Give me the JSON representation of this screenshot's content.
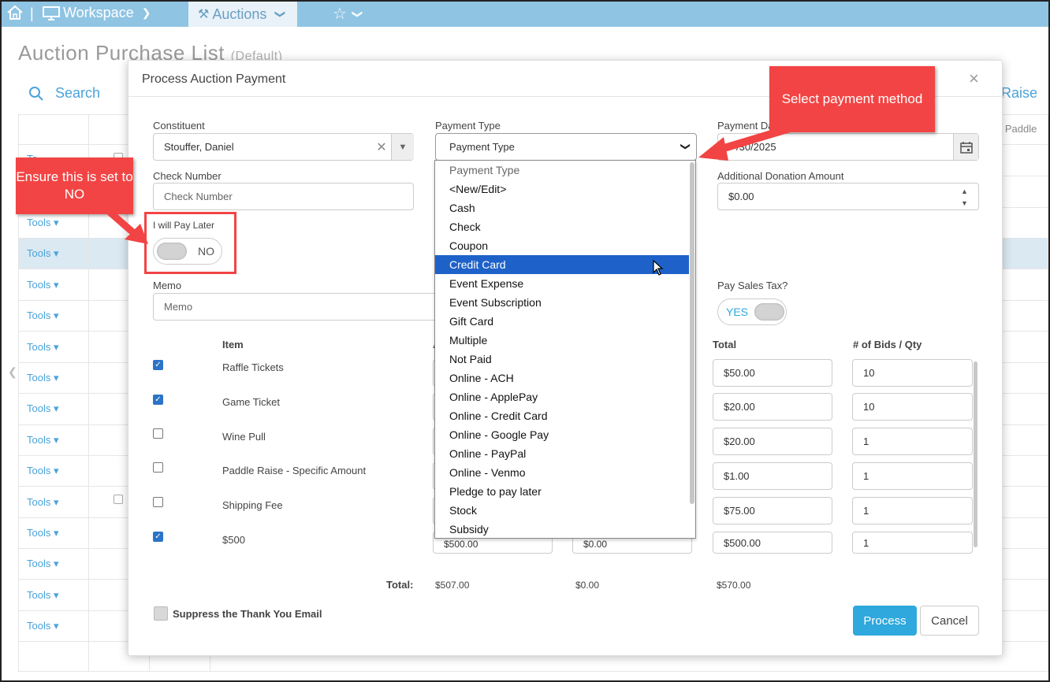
{
  "nav": {
    "workspace": "Workspace",
    "auctions": "Auctions"
  },
  "page": {
    "title": "Auction Purchase List",
    "subtitle": "(Default)",
    "search": "Search",
    "raise_partial": "Raise",
    "paddle_partial": "n Paddle",
    "tools_label": "Tools"
  },
  "modal": {
    "title": "Process Auction Payment",
    "constituent_label": "Constituent",
    "constituent_value": "Stouffer, Daniel",
    "payment_type_label": "Payment Type",
    "payment_type_value": "Payment Type",
    "payment_date_label": "Payment Da",
    "payment_date_value": "/30/2025",
    "check_number_label": "Check Number",
    "check_number_placeholder": "Check Number",
    "additional_donation_label": "Additional Donation Amount",
    "additional_donation_value": "$0.00",
    "pay_later_label": "I will Pay Later",
    "pay_later_value": "NO",
    "memo_label": "Memo",
    "memo_placeholder": "Memo",
    "sales_tax_label": "Pay Sales Tax?",
    "sales_tax_value": "YES",
    "col_item": "Item",
    "col_total": "Total",
    "col_bids": "# of Bids / Qty",
    "items": [
      {
        "name": "Raffle Tickets",
        "checked": true,
        "total": "$50.00",
        "qty": "10"
      },
      {
        "name": "Game Ticket",
        "checked": true,
        "total": "$20.00",
        "qty": "10"
      },
      {
        "name": "Wine Pull",
        "checked": false,
        "total": "$20.00",
        "qty": "1"
      },
      {
        "name": "Paddle Raise - Specific Amount",
        "checked": false,
        "total": "$1.00",
        "qty": "1"
      },
      {
        "name": "Shipping Fee",
        "checked": false,
        "total": "$75.00",
        "qty": "1"
      },
      {
        "name": "$500",
        "checked": true,
        "amount": "$500.00",
        "tax": "$0.00",
        "total": "$500.00",
        "qty": "1"
      }
    ],
    "totals_label": "Total:",
    "totals_amount": "$507.00",
    "totals_tax": "$0.00",
    "totals_total": "$570.00",
    "suppress_label": "Suppress the Thank You Email",
    "process_label": "Process",
    "cancel_label": "Cancel"
  },
  "dropdown": {
    "options": [
      "Payment Type",
      "<New/Edit>",
      "Cash",
      "Check",
      "Coupon",
      "Credit Card",
      "Event Expense",
      "Event Subscription",
      "Gift Card",
      "Multiple",
      "Not Paid",
      "Online - ACH",
      "Online - ApplePay",
      "Online - Credit Card",
      "Online - Google Pay",
      "Online - PayPal",
      "Online - Venmo",
      "Pledge to pay later",
      "Stock",
      "Subsidy"
    ],
    "selected": "Credit Card"
  },
  "callouts": {
    "payment": "Select payment method",
    "paylater": "Ensure this is set to NO"
  },
  "colors": {
    "accent": "#2ea8dd",
    "callout": "#f24444",
    "selected": "#1e62c9",
    "nav": "#8fc4e3"
  }
}
